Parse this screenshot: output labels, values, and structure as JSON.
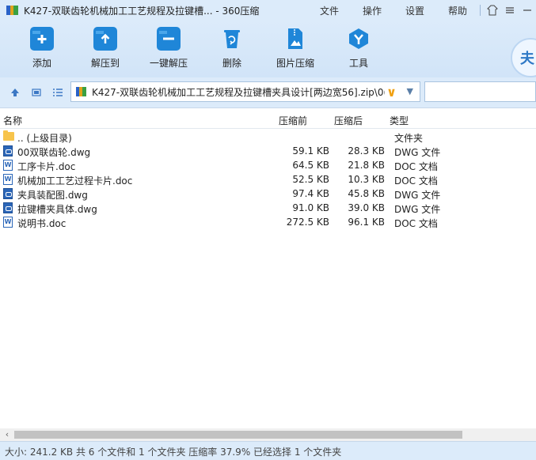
{
  "window": {
    "title": "K427-双联齿轮机械加工工艺规程及拉键槽... - 360压缩"
  },
  "menu": [
    "文件",
    "操作",
    "设置",
    "帮助"
  ],
  "toolbar": {
    "buttons": [
      {
        "label": "添加",
        "icon": "add-icon"
      },
      {
        "label": "解压到",
        "icon": "extract-to-icon"
      },
      {
        "label": "一键解压",
        "icon": "one-click-extract-icon"
      },
      {
        "label": "删除",
        "icon": "delete-icon"
      },
      {
        "label": "图片压缩",
        "icon": "image-compress-icon"
      },
      {
        "label": "工具",
        "icon": "tools-icon"
      }
    ],
    "badge": "夫"
  },
  "address": {
    "path": "K427-双联齿轮机械加工工艺规程及拉键槽夹具设计[两边宽56].zip\\0("
  },
  "columns": {
    "name": "名称",
    "compressed_before": "压缩前",
    "compressed_after": "压缩后",
    "type": "类型"
  },
  "files": [
    {
      "name": ".. (上级目录)",
      "before": "",
      "after": "",
      "type": "文件夹",
      "icon": "folder"
    },
    {
      "name": "00双联齿轮.dwg",
      "before": "59.1 KB",
      "after": "28.3 KB",
      "type": "DWG 文件",
      "icon": "dwg"
    },
    {
      "name": "工序卡片.doc",
      "before": "64.5 KB",
      "after": "21.8 KB",
      "type": "DOC 文档",
      "icon": "doc"
    },
    {
      "name": "机械加工工艺过程卡片.doc",
      "before": "52.5 KB",
      "after": "10.3 KB",
      "type": "DOC 文档",
      "icon": "doc"
    },
    {
      "name": "夹具装配图.dwg",
      "before": "97.4 KB",
      "after": "45.8 KB",
      "type": "DWG 文件",
      "icon": "dwg"
    },
    {
      "name": "拉键槽夹具体.dwg",
      "before": "91.0 KB",
      "after": "39.0 KB",
      "type": "DWG 文件",
      "icon": "dwg"
    },
    {
      "name": "说明书.doc",
      "before": "272.5 KB",
      "after": "96.1 KB",
      "type": "DOC 文档",
      "icon": "doc"
    }
  ],
  "status": "大小: 241.2 KB 共 6 个文件和 1 个文件夹 压缩率 37.9% 已经选择 1 个文件夹",
  "colors": {
    "chrome": "#dcebfa",
    "icon_blue": "#1f86d8",
    "folder": "#f7c44c"
  }
}
